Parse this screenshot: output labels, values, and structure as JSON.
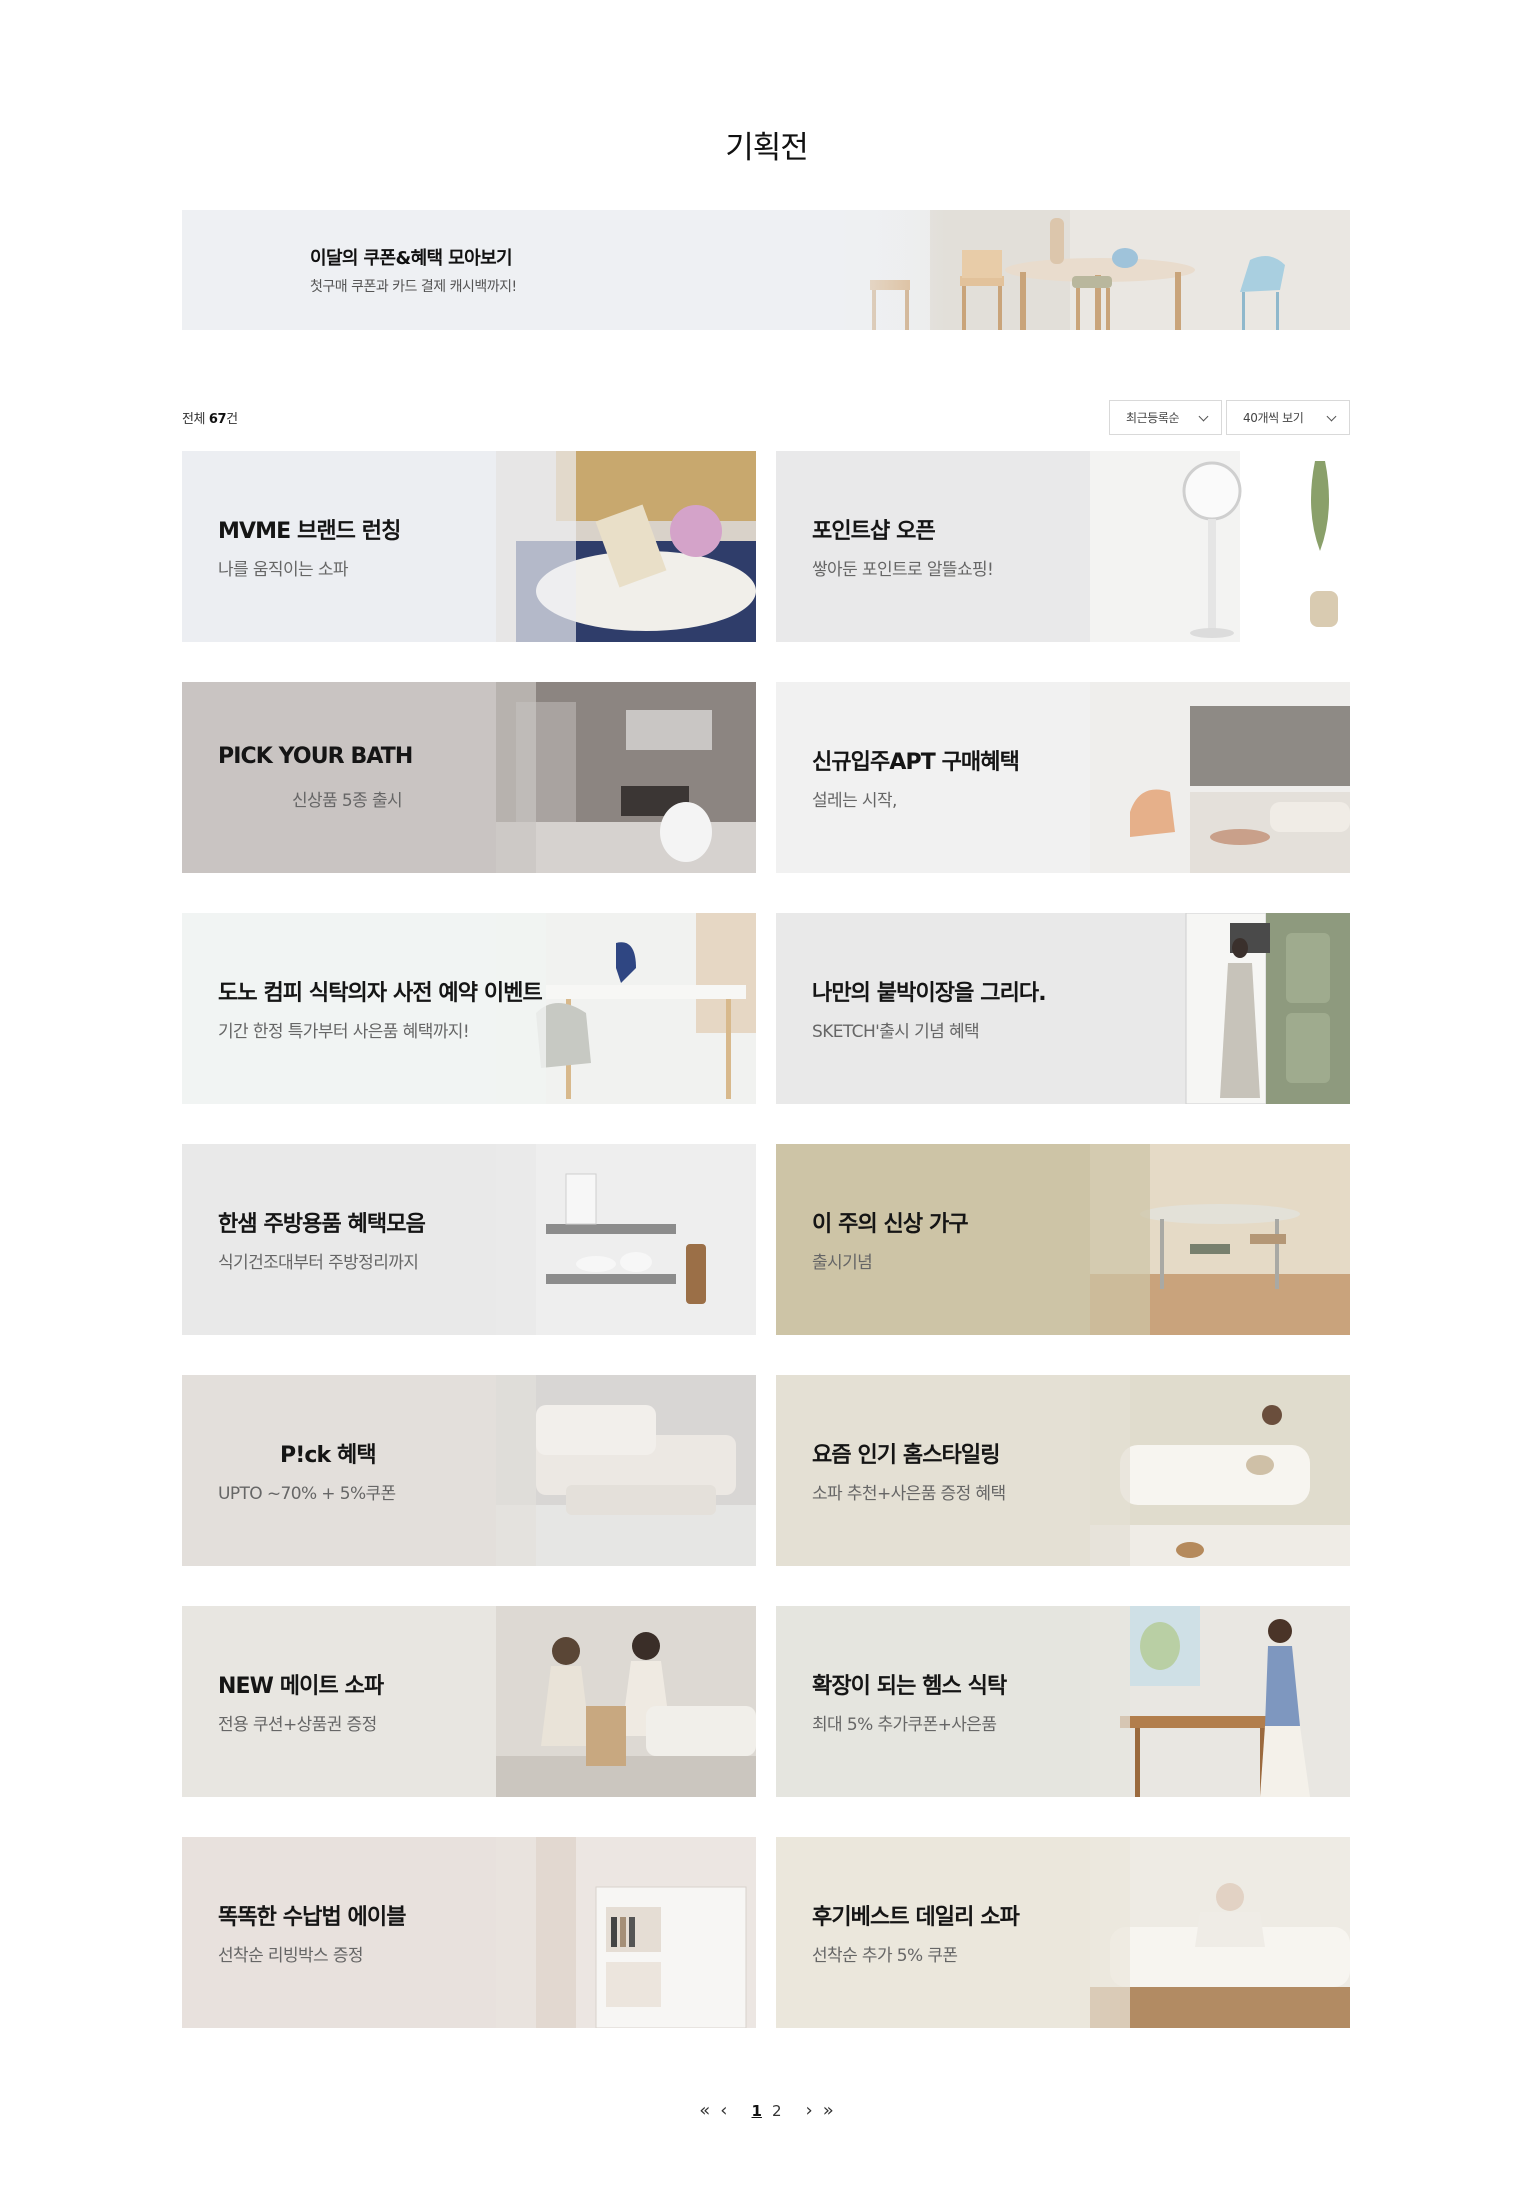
{
  "page": {
    "title": "기획전"
  },
  "top_banner": {
    "title": "이달의 쿠폰&혜택 모아보기",
    "subtitle": "첫구매 쿠폰과 카드 결제 캐시백까지!"
  },
  "toolbar": {
    "total_prefix": "전체 ",
    "total_count": "67",
    "total_suffix": "건",
    "sort_label": "최근등록순",
    "view_label": "40개씩 보기"
  },
  "cards": [
    {
      "title": "MVME 브랜드 런칭",
      "subtitle": "나를 움직이는 소파",
      "bg": "#eceef2"
    },
    {
      "title": "포인트샵 오픈",
      "subtitle": "쌓아둔 포인트로 알뜰쇼핑!",
      "bg": "#e9e9ea"
    },
    {
      "title": "PICK YOUR BATH",
      "subtitle": "신상품 5종 출시",
      "bg": "#c9c4c2"
    },
    {
      "title": "신규입주APT 구매혜택",
      "subtitle": "설레는 시작,",
      "bg": "#f1f1f1"
    },
    {
      "title": "도노 컴피 식탁의자 사전 예약 이벤트",
      "subtitle": "기간 한정 특가부터 사은품 혜택까지!",
      "bg": "#f1f4f3"
    },
    {
      "title": "나만의 붙박이장을 그리다.",
      "subtitle": "SKETCH'출시 기념 혜택",
      "bg": "#e9e9e9"
    },
    {
      "title": "한샘 주방용품 혜택모음",
      "subtitle": "식기건조대부터 주방정리까지",
      "bg": "#e9e9e9"
    },
    {
      "title": "이 주의 신상 가구",
      "subtitle": "출시기념",
      "bg": "#cdc4a6"
    },
    {
      "title": "P!ck 혜택",
      "subtitle": "UPTO ~70% + 5%쿠폰",
      "bg": "#e3dfdb"
    },
    {
      "title": "요즘 인기 홈스타일링",
      "subtitle": "소파 추천+사은품 증정 혜택",
      "bg": "#e4e0d4"
    },
    {
      "title": "NEW 메이트 소파",
      "subtitle": "전용 쿠션+상품권 증정",
      "bg": "#e8e6e1"
    },
    {
      "title": "확장이 되는 헴스 식탁",
      "subtitle": "최대 5% 추가쿠폰+사은품",
      "bg": "#e5e5df"
    },
    {
      "title": "똑똑한 수납법 에이블",
      "subtitle": "선착순 리빙박스 증정",
      "bg": "#e8e1dd"
    },
    {
      "title": "후기베스트 데일리 소파",
      "subtitle": "선착순 추가 5% 쿠폰",
      "bg": "#ebe7dc"
    }
  ],
  "pagination": {
    "first": "«",
    "prev": "‹",
    "pages": [
      "1",
      "2"
    ],
    "current": "1",
    "next": "›",
    "last": "»"
  }
}
